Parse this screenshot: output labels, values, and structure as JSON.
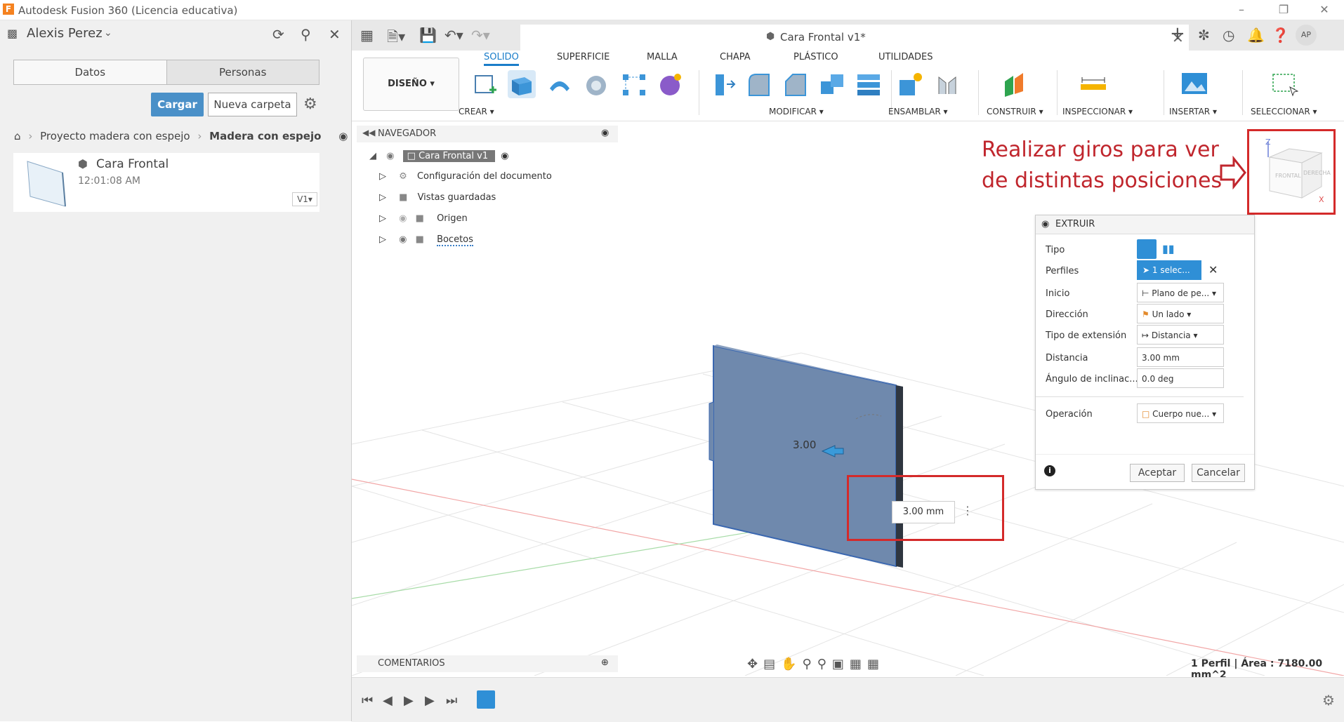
{
  "window": {
    "title": "Autodesk Fusion 360 (Licencia educativa)",
    "logo_letter": "F"
  },
  "data_panel": {
    "user_name": "Alexis Perez",
    "tabs": [
      "Datos",
      "Personas"
    ],
    "upload_label": "Cargar",
    "new_folder_label": "Nueva carpeta",
    "breadcrumb": [
      "Proyecto madera con espejo",
      "Madera con espejo"
    ],
    "file": {
      "name": "Cara Frontal",
      "time": "12:01:08 AM",
      "version": "V1"
    }
  },
  "document": {
    "tab_title": "Cara Frontal v1*",
    "user_initials": "AP"
  },
  "toolbar": {
    "workspace": "DISEÑO",
    "workspace_tabs": [
      "SOLIDO",
      "SUPERFICIE",
      "MALLA",
      "CHAPA",
      "PLÁSTICO",
      "UTILIDADES"
    ],
    "groups": {
      "crear": "CREAR",
      "modificar": "MODIFICAR",
      "ensamblar": "ENSAMBLAR",
      "construir": "CONSTRUIR",
      "inspeccionar": "INSPECCIONAR",
      "insertar": "INSERTAR",
      "seleccionar": "SELECCIONAR"
    }
  },
  "navigator": {
    "title": "NAVEGADOR",
    "root": "Cara Frontal v1",
    "items": [
      "Configuración del documento",
      "Vistas guardadas",
      "Origen",
      "Bocetos"
    ]
  },
  "annotation": {
    "line1": "Realizar giros para ver",
    "line2": "de distintas posiciones"
  },
  "viewcube": {
    "front": "FRONTAL",
    "right": "DERECHA",
    "z": "Z",
    "x": "X"
  },
  "extrude": {
    "title": "EXTRUIR",
    "rows": [
      {
        "label": "Tipo",
        "value": ""
      },
      {
        "label": "Perfiles",
        "value": "1 selec..."
      },
      {
        "label": "Inicio",
        "value": "Plano de pe..."
      },
      {
        "label": "Dirección",
        "value": "Un lado"
      },
      {
        "label": "Tipo de extensión",
        "value": "Distancia"
      },
      {
        "label": "Distancia",
        "value": "3.00 mm"
      },
      {
        "label": "Ángulo de inclinac...",
        "value": "0.0 deg"
      },
      {
        "label": "Operación",
        "value": "Cuerpo nue..."
      }
    ],
    "ok_label": "Aceptar",
    "cancel_label": "Cancelar"
  },
  "viewport": {
    "dimension_input": "3.00 mm",
    "dimension_label": "3.00"
  },
  "comments": {
    "title": "COMENTARIOS"
  },
  "status": {
    "text": "1 Perfil | Área : 7180.00 mm^2"
  },
  "colors": {
    "accent": "#1a7dc9",
    "annotation_red": "#c0262d",
    "body_fill": "#6f89ad"
  }
}
